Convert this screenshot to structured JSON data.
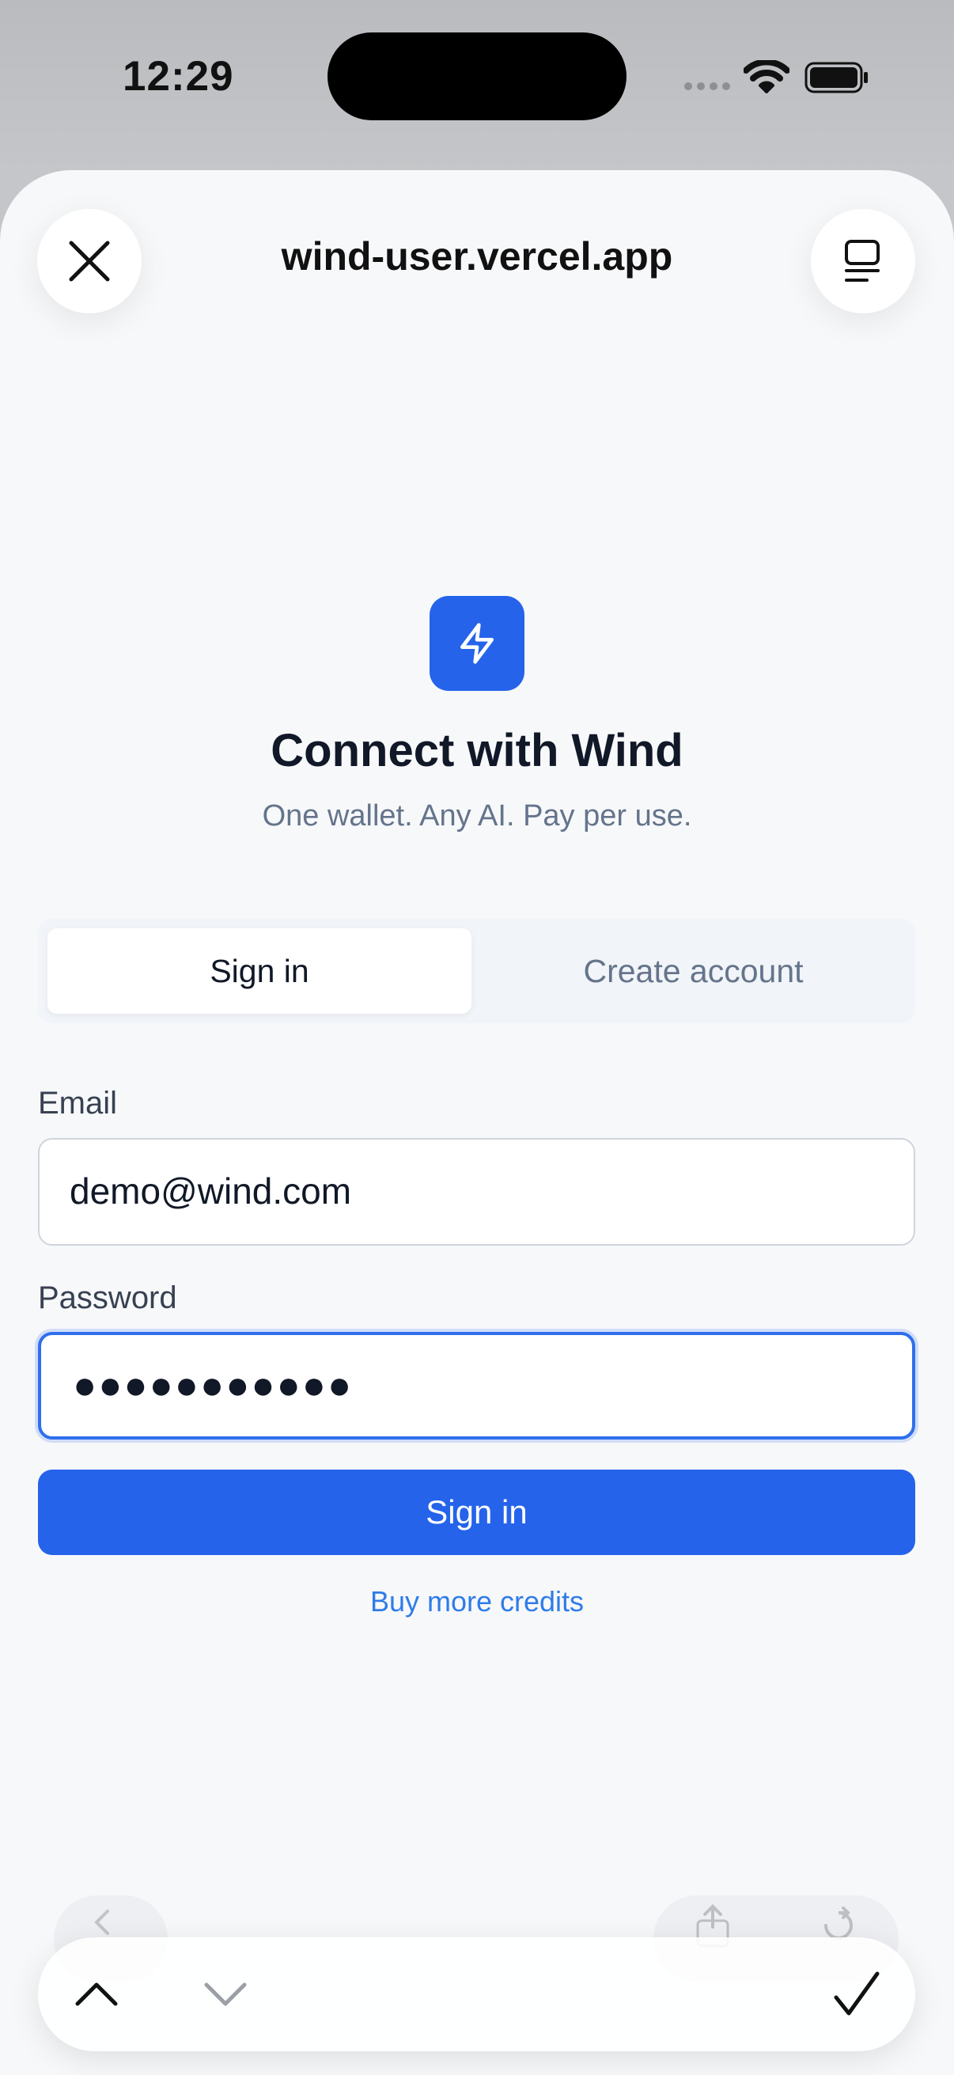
{
  "status_bar": {
    "time": "12:29",
    "icons": [
      "signal-icon",
      "wifi-icon",
      "battery-icon"
    ]
  },
  "browser": {
    "url": "wind-user.vercel.app",
    "icons": [
      "close-icon",
      "tabs-icon"
    ]
  },
  "page": {
    "logo_icon": "lightning-bolt-icon",
    "title": "Connect with Wind",
    "subtitle": "One wallet. Any AI. Pay per use.",
    "tabs": [
      {
        "label": "Sign in",
        "active": true
      },
      {
        "label": "Create account",
        "active": false
      }
    ],
    "email_label": "Email",
    "email_value": "demo@wind.com",
    "password_label": "Password",
    "password_value": "●●●●●●●●●●●",
    "submit_label": "Sign in",
    "link_label": "Buy more credits"
  },
  "toolbar": {
    "icons": [
      "chevron-up-icon",
      "chevron-down-icon",
      "checkmark-icon"
    ],
    "background_icons": [
      "back-icon",
      "share-icon",
      "refresh-icon"
    ]
  },
  "colors": {
    "accent": "#2563eb",
    "link": "#2f7ce8",
    "heading": "#111827",
    "muted": "#64748b",
    "sheet_background": "#f7f8fa"
  }
}
